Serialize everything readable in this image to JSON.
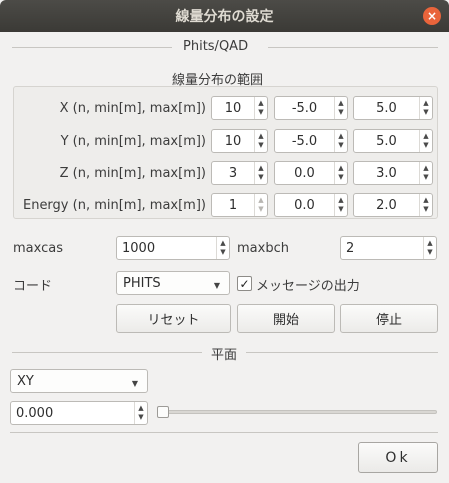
{
  "window": {
    "title": "線量分布の設定",
    "close_glyph": "×"
  },
  "phits_section": {
    "title": "Phits/QAD"
  },
  "range_group": {
    "title": "線量分布の範囲",
    "rows": [
      {
        "label": "X (n, min[m], max[m])",
        "n": "10",
        "min": "-5.0",
        "max": "5.0"
      },
      {
        "label": "Y (n, min[m], max[m])",
        "n": "10",
        "min": "-5.0",
        "max": "5.0"
      },
      {
        "label": "Z (n, min[m], max[m])",
        "n": "3",
        "min": "0.0",
        "max": "3.0"
      },
      {
        "label": "Energy (n, min[m], max[m])",
        "n": "1",
        "min": "0.0",
        "max": "2.0"
      }
    ]
  },
  "params": {
    "maxcas_label": "maxcas",
    "maxcas_value": "1000",
    "maxbch_label": "maxbch",
    "maxbch_value": "2"
  },
  "code": {
    "label": "コード",
    "selected": "PHITS",
    "message_output_label": "メッセージの出力",
    "message_output_checked": true,
    "check_glyph": "✓"
  },
  "buttons": {
    "reset": "リセット",
    "start": "開始",
    "stop": "停止"
  },
  "plane_section": {
    "title": "平面",
    "plane_selected": "XY",
    "position_value": "0.000",
    "slider_fraction": 0.0
  },
  "footer": {
    "ok_label": "Ok"
  },
  "icons": {
    "spin_up": "▲",
    "spin_down": "▼",
    "combo_caret": "▼"
  },
  "colors": {
    "titlebar": "#3b3a36",
    "close_button": "#e9643b"
  }
}
